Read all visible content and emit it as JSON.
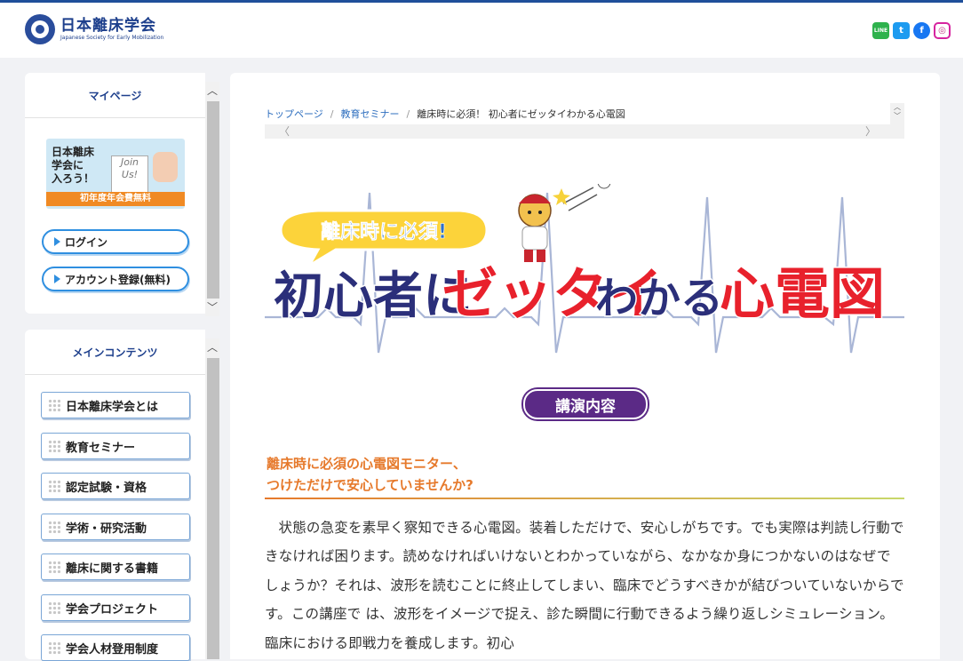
{
  "header": {
    "logo_ja": "日本離床学会",
    "logo_en": "Japanese Society for Early Mobilization",
    "social": [
      {
        "name": "line-icon",
        "label": "LINE"
      },
      {
        "name": "twitter-icon",
        "label": "t"
      },
      {
        "name": "facebook-icon",
        "label": "f"
      },
      {
        "name": "instagram-icon",
        "label": "◎"
      }
    ]
  },
  "sidebar": {
    "mypage": {
      "title": "マイページ",
      "banner": {
        "line1": "日本離床\n学会に\n入ろう！",
        "card": "Join\nUs!",
        "foot": "初年度年会費無料"
      },
      "login": "ログイン",
      "register": "アカウント登録(無料)"
    },
    "main_contents": {
      "title": "メインコンテンツ",
      "items": [
        "日本離床学会とは",
        "教育セミナー",
        "認定試験・資格",
        "学術・研究活動",
        "離床に関する書籍",
        "学会プロジェクト",
        "学会人材登用制度"
      ]
    }
  },
  "breadcrumb": {
    "home": "トップページ",
    "seminar": "教育セミナー",
    "current": "離床時に必須！ 初心者にゼッタイわかる心電図"
  },
  "hero": {
    "bubble": "離床時に必須!",
    "title_a": "初心者に",
    "title_b": "ゼッタイ",
    "title_c": "わかる",
    "title_d": "心電図"
  },
  "section": {
    "label": "講演内容",
    "lead_1": "離床時に必須の心電図モニター、",
    "lead_2": "つけただけで安心していませんか?",
    "body": "状態の急変を素早く察知できる心電図。装着しただけで、安心しがちです。でも実際は判読し行動できなければ困ります。読めなければいけないとわかっていながら、なかなか身につかないのはなぜでしょうか？それは、波形を読むことに終止してしまい、臨床でどうすべきかが結びついていないからです。この講座で は、波形をイメージで捉え、診た瞬間に行動できるよう繰り返しシミュレーション。臨床における即戦力を養成します。初心"
  },
  "colors": {
    "brand": "#1d3f8c",
    "accent_orange": "#e6792b",
    "label_purple": "#5b2a86",
    "title_red": "#e8212c",
    "title_navy": "#2b2f7a"
  }
}
